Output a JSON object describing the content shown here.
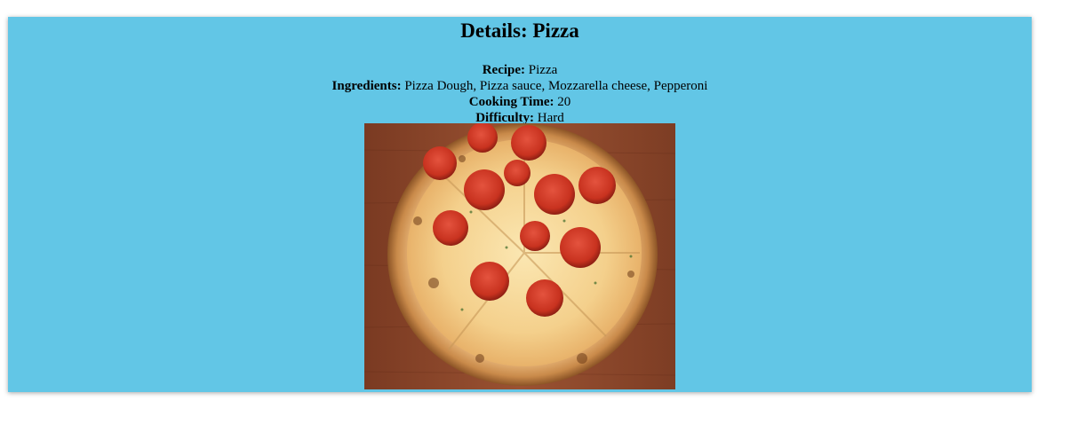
{
  "page": {
    "title_prefix": "Details: ",
    "title_name": "Pizza"
  },
  "details": {
    "recipe_label": "Recipe:",
    "recipe_value": "Pizza",
    "ingredients_label": "Ingredients:",
    "ingredients_value": "Pizza Dough, Pizza sauce, Mozzarella cheese, Pepperoni",
    "cooking_time_label": "Cooking Time:",
    "cooking_time_value": "20",
    "difficulty_label": "Difficulty:",
    "difficulty_value": "Hard"
  },
  "colors": {
    "card_background": "#62c6e6"
  }
}
